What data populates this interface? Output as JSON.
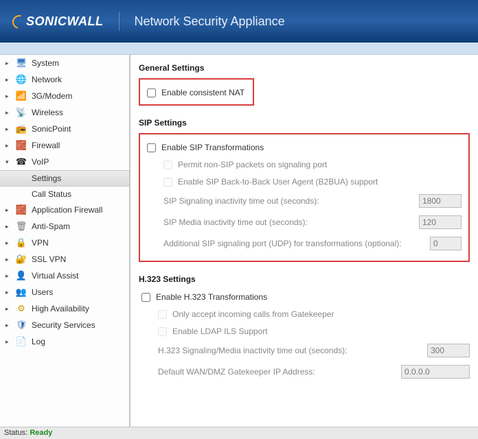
{
  "brand": "SONICWALL",
  "header_title": "Network Security Appliance",
  "sidebar": {
    "items": [
      {
        "label": "System"
      },
      {
        "label": "Network"
      },
      {
        "label": "3G/Modem"
      },
      {
        "label": "Wireless"
      },
      {
        "label": "SonicPoint"
      },
      {
        "label": "Firewall"
      },
      {
        "label": "VoIP",
        "expanded": true,
        "children": [
          {
            "label": "Settings",
            "selected": true
          },
          {
            "label": "Call Status"
          }
        ]
      },
      {
        "label": "Application Firewall"
      },
      {
        "label": "Anti-Spam"
      },
      {
        "label": "VPN"
      },
      {
        "label": "SSL VPN"
      },
      {
        "label": "Virtual Assist"
      },
      {
        "label": "Users"
      },
      {
        "label": "High Availability"
      },
      {
        "label": "Security Services"
      },
      {
        "label": "Log"
      }
    ]
  },
  "main": {
    "general": {
      "title": "General Settings",
      "enable_consistent_nat": "Enable consistent NAT"
    },
    "sip": {
      "title": "SIP Settings",
      "enable_transform": "Enable SIP Transformations",
      "permit_non_sip": "Permit non-SIP packets on signaling port",
      "enable_b2bua": "Enable SIP Back-to-Back User Agent (B2BUA) support",
      "sig_timeout_label": "SIP Signaling inactivity time out (seconds):",
      "sig_timeout_value": "1800",
      "media_timeout_label": "SIP Media inactivity time out (seconds):",
      "media_timeout_value": "120",
      "extra_port_label": "Additional SIP signaling port (UDP) for transformations (optional):",
      "extra_port_value": "0"
    },
    "h323": {
      "title": "H.323 Settings",
      "enable_transform": "Enable H.323 Transformations",
      "only_gatekeeper": "Only accept incoming calls from Gatekeeper",
      "enable_ldap": "Enable LDAP ILS Support",
      "timeout_label": "H.323 Signaling/Media inactivity time out (seconds):",
      "timeout_value": "300",
      "gatekeeper_label": "Default WAN/DMZ Gatekeeper IP Address:",
      "gatekeeper_value": "0.0.0.0"
    }
  },
  "status": {
    "prefix": "Status:",
    "value": "Ready"
  }
}
